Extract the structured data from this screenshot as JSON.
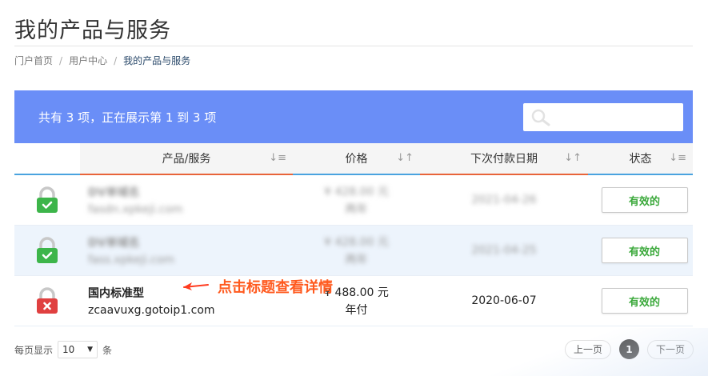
{
  "page": {
    "title": "我的产品与服务"
  },
  "breadcrumb": {
    "items": [
      "门户首页",
      "用户中心",
      "我的产品与服务"
    ]
  },
  "panel": {
    "summary": "共有 3 项，正在展示第 1 到 3 项",
    "search": {
      "placeholder": "",
      "icon": "search-icon"
    }
  },
  "table": {
    "columns": [
      "",
      "产品/服务",
      "价格",
      "下次付款日期",
      "状态"
    ],
    "sort_icons": [
      "sort-desc-icon",
      "sort-icon",
      "sort-icon",
      "sort-desc-icon"
    ],
    "rows": [
      {
        "lock_color": "#3db54a",
        "product_name": "DV单域名",
        "domain": "fasdn.xpkeji.com",
        "price": "¥ 428.00 元",
        "cycle": "两年",
        "next_due": "2021-04-26",
        "status": "有效的",
        "blurred": true
      },
      {
        "lock_color": "#3db54a",
        "product_name": "DV单域名",
        "domain": "fass.xpkeji.com",
        "price": "¥ 428.00 元",
        "cycle": "两年",
        "next_due": "2021-04-25",
        "status": "有效的",
        "blurred": true
      },
      {
        "lock_color": "#e04040",
        "product_name": "国内标准型",
        "domain": "zcaavuxg.gotoip1.com",
        "price": "¥ 488.00 元",
        "cycle": "年付",
        "next_due": "2020-06-07",
        "status": "有效的",
        "blurred": false
      }
    ]
  },
  "annotation": {
    "text": "点击标题查看详情",
    "color": "#ff5a1f"
  },
  "footer": {
    "per_page_prefix": "每页显示",
    "per_page_value": "10",
    "per_page_suffix": "条",
    "prev_label": "上一页",
    "current_page": "1",
    "next_label": "下一页"
  },
  "colors": {
    "header_bg": "#6a8ef7",
    "status_text": "#3aa83a",
    "alt_row_bg": "#edf4fc"
  }
}
